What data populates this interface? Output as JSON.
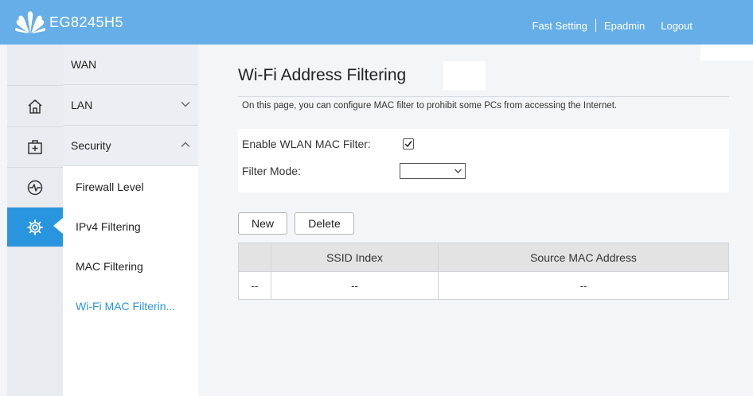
{
  "header": {
    "brand": "EG8245H5",
    "links": [
      "Fast Setting",
      "Epadmin",
      "Logout"
    ]
  },
  "rail": {
    "items": [
      {
        "icon": "home-icon"
      },
      {
        "icon": "medical-kit-icon"
      },
      {
        "icon": "diagnostics-icon"
      },
      {
        "icon": "gear-icon",
        "active": true
      }
    ]
  },
  "menu": {
    "items": [
      "WAN",
      "LAN",
      "Security"
    ],
    "sub_items": [
      "Firewall Level",
      "IPv4 Filtering",
      "MAC Filtering",
      "Wi-Fi MAC Filterin..."
    ]
  },
  "content": {
    "title": "Wi-Fi Address Filtering",
    "description": "On this page, you can configure MAC filter to prohibit some PCs from accessing the Internet.",
    "enable_label": "Enable WLAN MAC Filter:",
    "enable_checked": true,
    "filter_mode_label": "Filter Mode:",
    "filter_mode_value": "",
    "new_button": "New",
    "delete_button": "Delete",
    "table": {
      "headers": [
        "",
        "SSID Index",
        "Source MAC Address"
      ],
      "rows": [
        [
          "--",
          "--",
          "--"
        ]
      ]
    }
  },
  "colors": {
    "header": "#66aee8",
    "accent": "#2a95df",
    "rail": "#e8ecf1"
  }
}
